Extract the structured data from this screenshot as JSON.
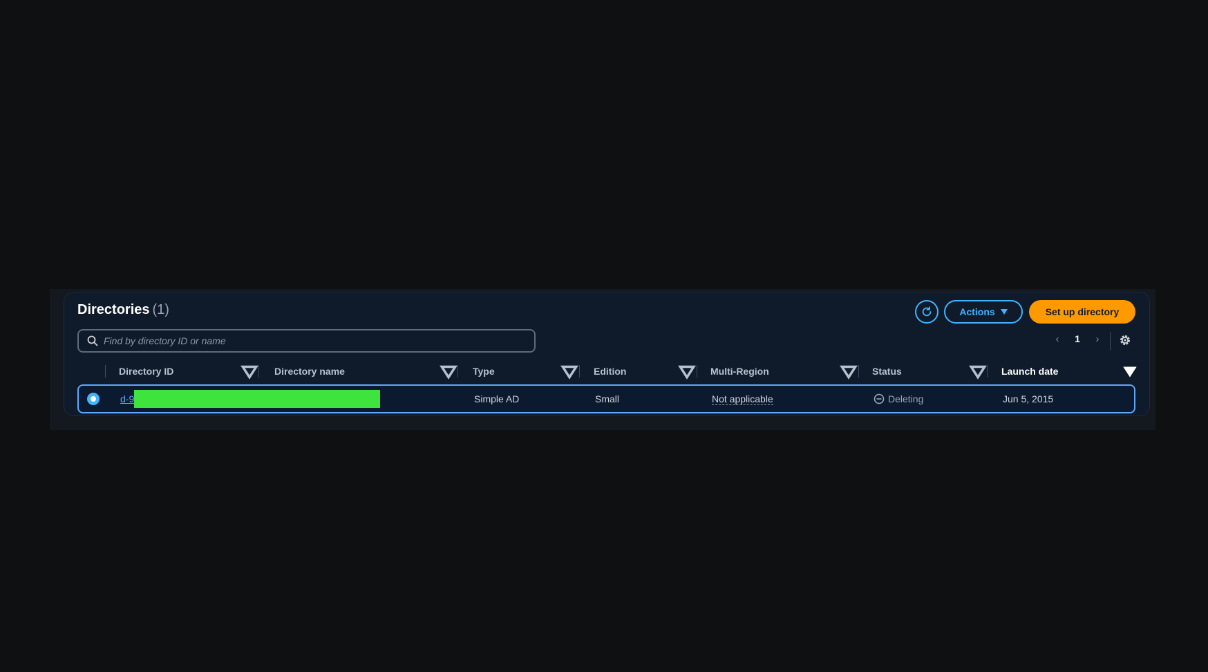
{
  "panel": {
    "title": "Directories",
    "count": "(1)"
  },
  "search": {
    "placeholder": "Find by directory ID or name",
    "value": ""
  },
  "toolbar": {
    "refresh_icon": "refresh-icon",
    "actions_label": "Actions",
    "setup_label": "Set up directory"
  },
  "pagination": {
    "prev": "‹",
    "page": "1",
    "next": "›"
  },
  "columns": [
    {
      "label": "Directory ID"
    },
    {
      "label": "Directory name"
    },
    {
      "label": "Type"
    },
    {
      "label": "Edition"
    },
    {
      "label": "Multi-Region"
    },
    {
      "label": "Status"
    },
    {
      "label": "Launch date"
    }
  ],
  "rows": [
    {
      "selected": true,
      "directory_id": "d-9",
      "directory_name": "",
      "type": "Simple AD",
      "edition": "Small",
      "multi_region": "Not applicable",
      "status": "Deleting",
      "launch_date": "Jun 5, 2015"
    }
  ],
  "colors": {
    "accent": "#42b4ff",
    "primary_button": "#ff9900",
    "redaction": "#3ee33e"
  }
}
